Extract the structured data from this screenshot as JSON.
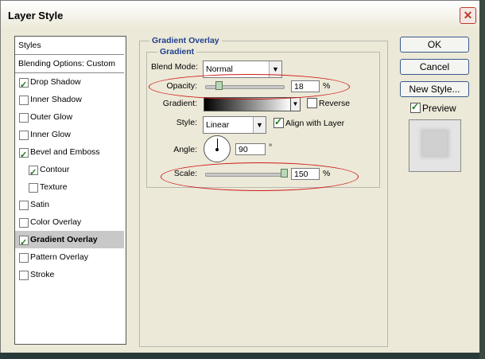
{
  "window": {
    "title": "Layer Style"
  },
  "styles_list": {
    "header": "Styles",
    "blending_options": "Blending Options: Custom",
    "items": [
      {
        "label": "Drop Shadow",
        "checked": true
      },
      {
        "label": "Inner Shadow",
        "checked": false
      },
      {
        "label": "Outer Glow",
        "checked": false
      },
      {
        "label": "Inner Glow",
        "checked": false
      },
      {
        "label": "Bevel and Emboss",
        "checked": true
      },
      {
        "label": "Contour",
        "checked": true,
        "indent": true
      },
      {
        "label": "Texture",
        "checked": false,
        "indent": true
      },
      {
        "label": "Satin",
        "checked": false
      },
      {
        "label": "Color Overlay",
        "checked": false
      },
      {
        "label": "Gradient Overlay",
        "checked": true,
        "selected": true
      },
      {
        "label": "Pattern Overlay",
        "checked": false
      },
      {
        "label": "Stroke",
        "checked": false
      }
    ]
  },
  "gradient_overlay": {
    "section_title": "Gradient Overlay",
    "group_title": "Gradient",
    "blend_mode_label": "Blend Mode:",
    "blend_mode_value": "Normal",
    "opacity_label": "Opacity:",
    "opacity_value": "18",
    "opacity_unit": "%",
    "gradient_label": "Gradient:",
    "reverse_label": "Reverse",
    "reverse_checked": false,
    "style_label": "Style:",
    "style_value": "Linear",
    "align_label": "Align with Layer",
    "align_checked": true,
    "angle_label": "Angle:",
    "angle_value": "90",
    "angle_unit": "°",
    "scale_label": "Scale:",
    "scale_value": "150",
    "scale_unit": "%"
  },
  "buttons": {
    "ok": "OK",
    "cancel": "Cancel",
    "new_style": "New Style...",
    "preview_label": "Preview",
    "preview_checked": true
  },
  "colors": {
    "section_title": "#1f3f8f",
    "annotation": "#d01818"
  }
}
